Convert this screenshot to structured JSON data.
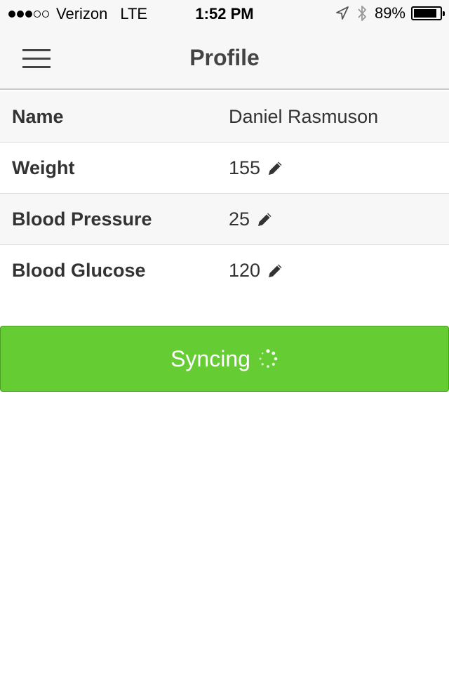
{
  "status_bar": {
    "signal_bars_filled": 3,
    "signal_bars_total": 5,
    "carrier": "Verizon",
    "network": "LTE",
    "time": "1:52 PM",
    "battery_percent": "89%",
    "battery_level": 0.89
  },
  "nav": {
    "title": "Profile",
    "menu_icon": "hamburger-menu-icon"
  },
  "profile": {
    "rows": [
      {
        "label": "Name",
        "value": "Daniel Rasmuson",
        "editable": false
      },
      {
        "label": "Weight",
        "value": "155",
        "editable": true
      },
      {
        "label": "Blood Pressure",
        "value": "25",
        "editable": true
      },
      {
        "label": "Blood Glucose",
        "value": "120",
        "editable": true
      }
    ]
  },
  "sync_button": {
    "label": "Syncing",
    "spinner_icon": "loading-spinner-icon"
  },
  "colors": {
    "accent_green": "#66cc33",
    "bar_background": "#f7f7f7",
    "text_dark": "#333333"
  }
}
